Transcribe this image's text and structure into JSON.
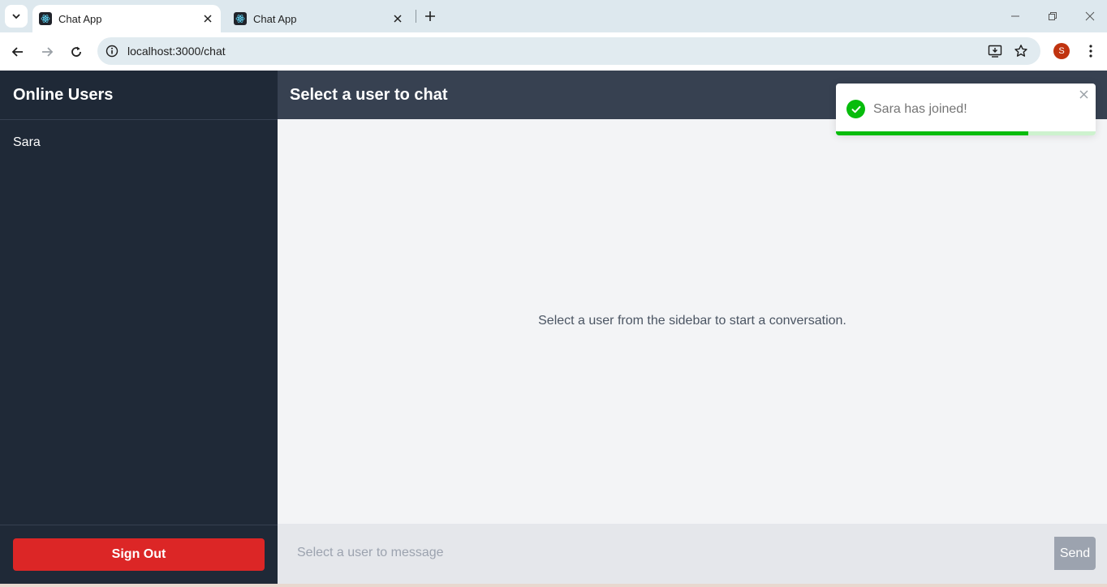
{
  "browser": {
    "tabs": [
      {
        "title": "Chat App",
        "active": true
      },
      {
        "title": "Chat App",
        "active": false
      }
    ],
    "url": "localhost:3000/chat",
    "profile_initial": "S"
  },
  "sidebar": {
    "title": "Online Users",
    "users": [
      "Sara"
    ],
    "signout_label": "Sign Out"
  },
  "main": {
    "header_title": "Select a user to chat",
    "placeholder_message": "Select a user from the sidebar to start a conversation.",
    "input_placeholder": "Select a user to message",
    "send_label": "Send"
  },
  "toast": {
    "message": "Sara has joined!",
    "progress": 0.74
  },
  "colors": {
    "sidebar_bg": "#1f2937",
    "header_bg": "#374151",
    "signout": "#dc2626",
    "toast_success": "#07bc0c",
    "send_disabled": "#9ca3af"
  }
}
